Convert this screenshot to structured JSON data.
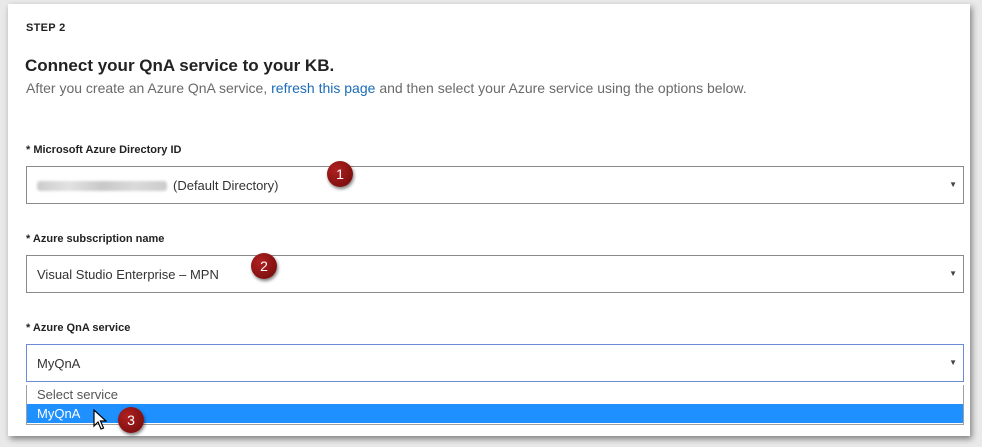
{
  "step_label": "STEP 2",
  "heading": "Connect your QnA service to your KB.",
  "intro": {
    "before": "After you create an Azure QnA service,",
    "link": "refresh this page",
    "after": "and then select your Azure service using the options below."
  },
  "fields": [
    {
      "label": "* Microsoft Azure Directory ID",
      "value": "(Default Directory)",
      "badge": "1"
    },
    {
      "label": "* Azure subscription name",
      "value": "Visual Studio Enterprise – MPN",
      "badge": "2"
    },
    {
      "label": "* Azure QnA service",
      "value": "MyQnA"
    }
  ],
  "dropdown": {
    "options": [
      "Select service",
      "MyQnA"
    ],
    "selected_badge": "3"
  },
  "icons": {
    "arrow": "▼"
  },
  "colors": {
    "accent": "#1e90ff",
    "link": "#1a6bb8",
    "badge": "#8b1010"
  }
}
